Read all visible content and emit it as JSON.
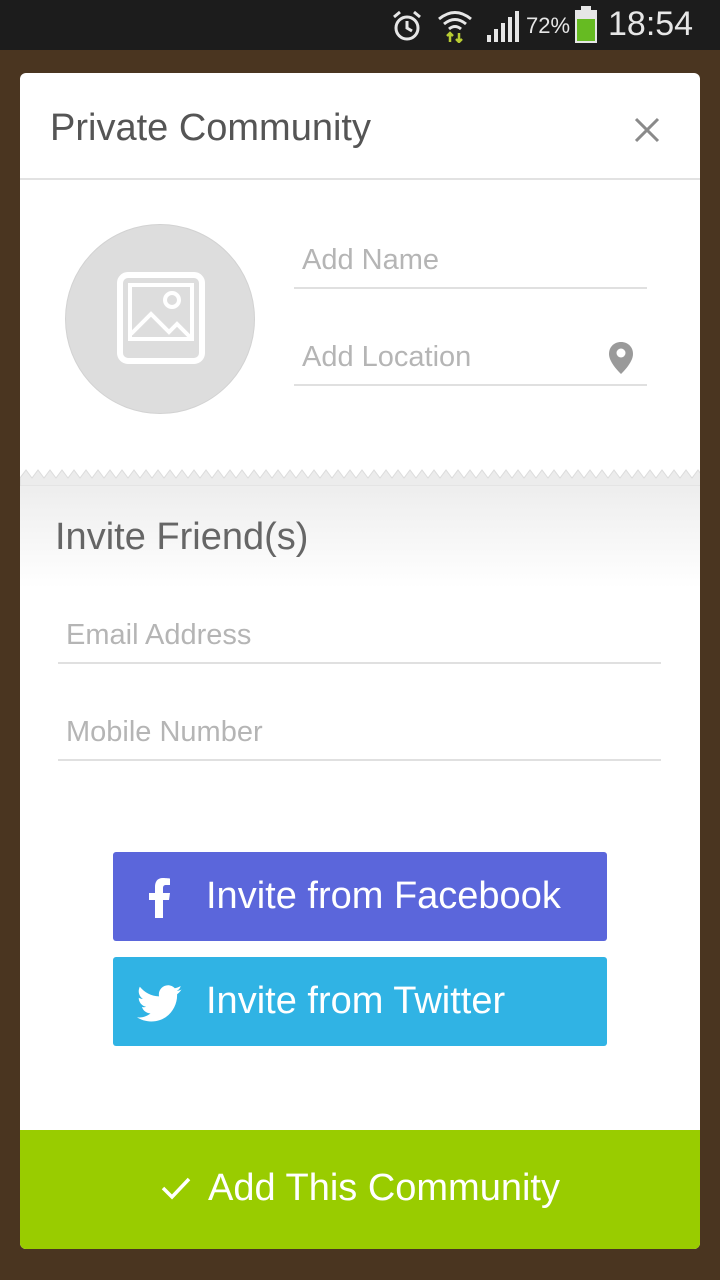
{
  "status_bar": {
    "battery_percent": "72%",
    "time": "18:54",
    "icons": [
      "alarm-icon",
      "wifi-icon",
      "signal-icon",
      "battery-icon"
    ]
  },
  "dialog": {
    "title": "Private Community",
    "close_icon": "close-icon"
  },
  "community": {
    "image_icon": "image-icon",
    "name_placeholder": "Add Name",
    "location_placeholder": "Add Location",
    "location_icon": "pin-icon"
  },
  "invite": {
    "title": "Invite Friend(s)",
    "email_placeholder": "Email Address",
    "mobile_placeholder": "Mobile Number",
    "facebook_label": "Invite from Facebook",
    "twitter_label": "Invite from Twitter"
  },
  "footer": {
    "add_label": "Add This Community"
  },
  "colors": {
    "facebook": "#5b66db",
    "twitter": "#30b3e4",
    "accent_green": "#99cc00",
    "backdrop": "#4a3520"
  }
}
